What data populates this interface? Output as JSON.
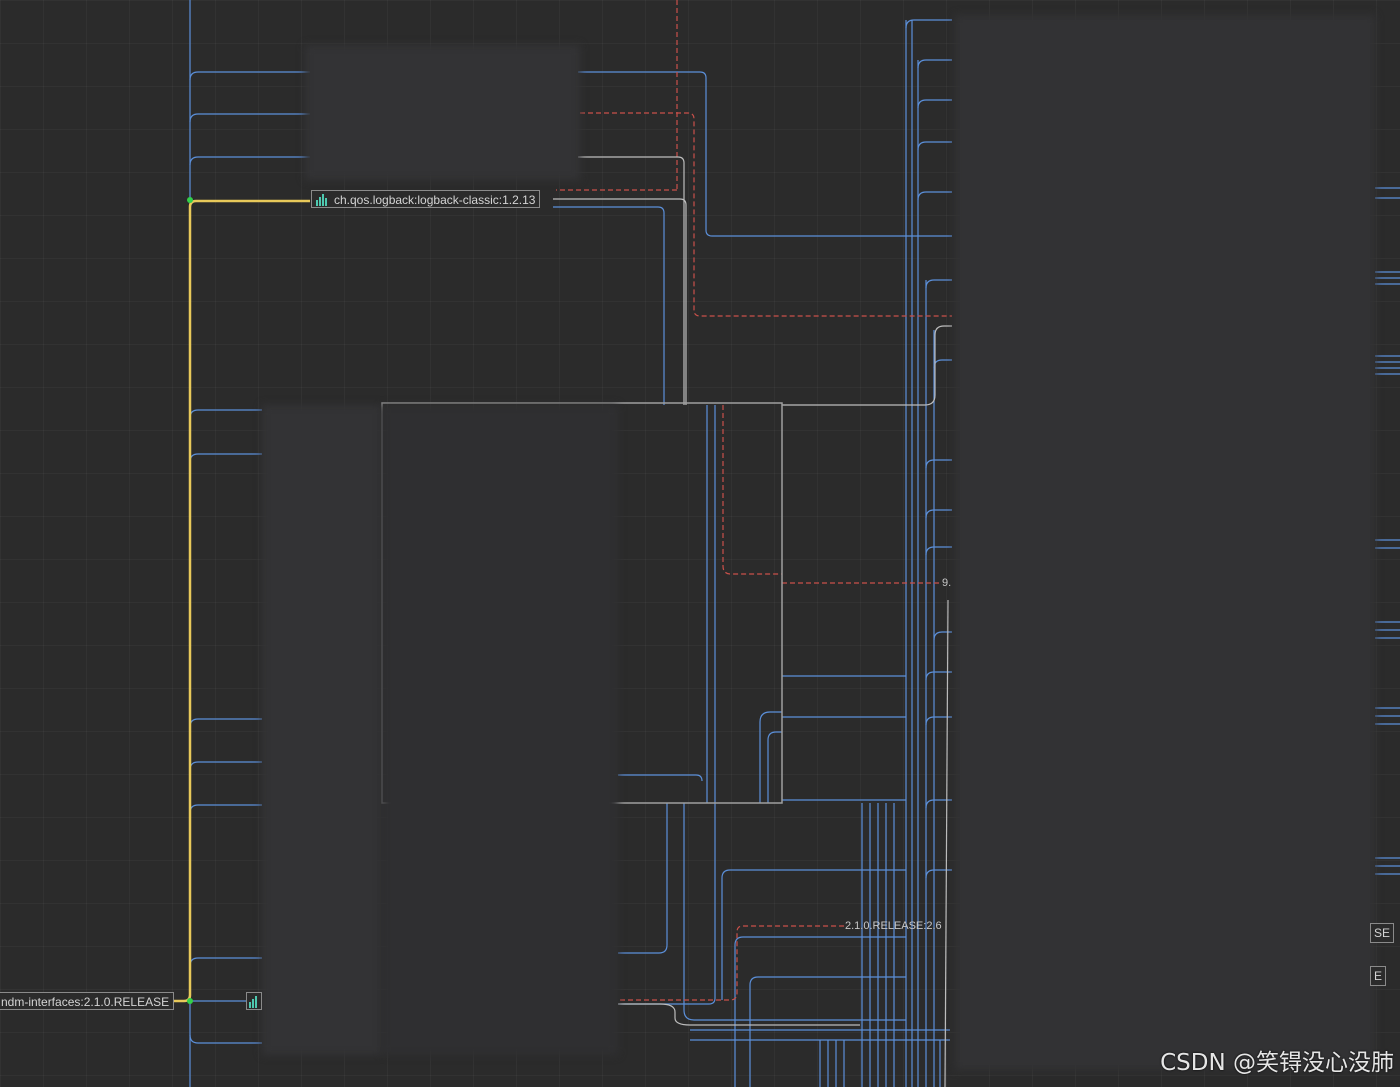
{
  "nodes": {
    "logback_classic": "ch.qos.logback:logback-classic:1.2.13",
    "interfaces": "ndm-interfaces:2.1.0.RELEASE"
  },
  "edge_labels": {
    "release_26": "2.1.0.RELEASE:2.6",
    "partial_9": "9.",
    "partial_se": "SE",
    "partial_e": "E"
  },
  "watermark": "CSDN @笑锝没心没肺",
  "colors": {
    "background": "#2b2b2b",
    "dependency_edge": "#5b8fd9",
    "selected_edge": "#e8c95a",
    "conflict_edge": "#c9504a",
    "neutral_edge": "#bdbdbd"
  }
}
